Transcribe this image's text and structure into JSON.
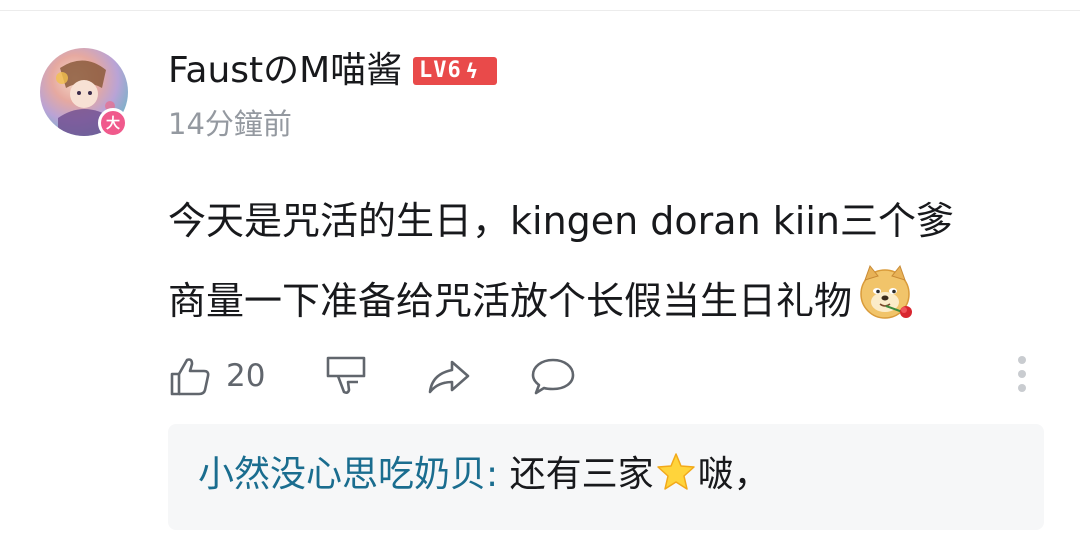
{
  "comment": {
    "username": "FaustのM喵酱",
    "level": "LV6",
    "level_bolt": "ϟ",
    "avatar_badge": "大",
    "timestamp": "14分鐘前",
    "text_line1": "今天是咒活的生日，kingen doran kiin三个爹",
    "text_line2": "商量一下准备给咒活放个长假当生日礼物",
    "emoji": "doge-rose-emoji",
    "like_count": "20"
  },
  "reply": {
    "username": "小然没心思吃奶贝",
    "colon": ":",
    "text_before": " 还有三家",
    "emoji": "star-emoji",
    "text_after": "啵，"
  },
  "colors": {
    "level_badge": "#e94a4a",
    "reply_username": "#1a6d8f",
    "timestamp": "#9499a0",
    "avatar_badge": "#f05a8c"
  }
}
